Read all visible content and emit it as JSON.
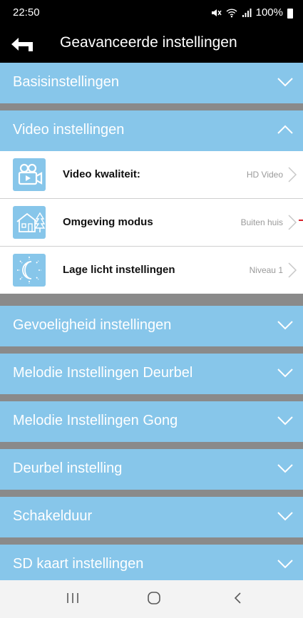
{
  "status_bar": {
    "time": "22:50",
    "battery": "100%"
  },
  "app_bar": {
    "title": "Geavanceerde instellingen",
    "back_icon": "back-arrow-icon"
  },
  "sections": [
    {
      "label": "Basisinstellingen",
      "expanded": false
    },
    {
      "label": "Video instellingen",
      "expanded": true
    },
    {
      "label": "Gevoeligheid instellingen",
      "expanded": false
    },
    {
      "label": "Melodie Instellingen Deurbel",
      "expanded": false
    },
    {
      "label": "Melodie Instellingen Gong",
      "expanded": false
    },
    {
      "label": "Deurbel instelling",
      "expanded": false
    },
    {
      "label": "Schakelduur",
      "expanded": false
    },
    {
      "label": "SD kaart instellingen",
      "expanded": false
    }
  ],
  "video_rows": [
    {
      "label": "Video kwaliteit:",
      "value": "HD Video",
      "icon": "video-camera-icon"
    },
    {
      "label": "Omgeving modus",
      "value": "Buiten huis",
      "icon": "house-tree-icon"
    },
    {
      "label": "Lage licht instellingen",
      "value": "Niveau 1",
      "icon": "day-night-icon"
    }
  ],
  "colors": {
    "section_bg": "#87c6ea",
    "separator": "#8a8a8a",
    "app_bar": "#000000"
  }
}
